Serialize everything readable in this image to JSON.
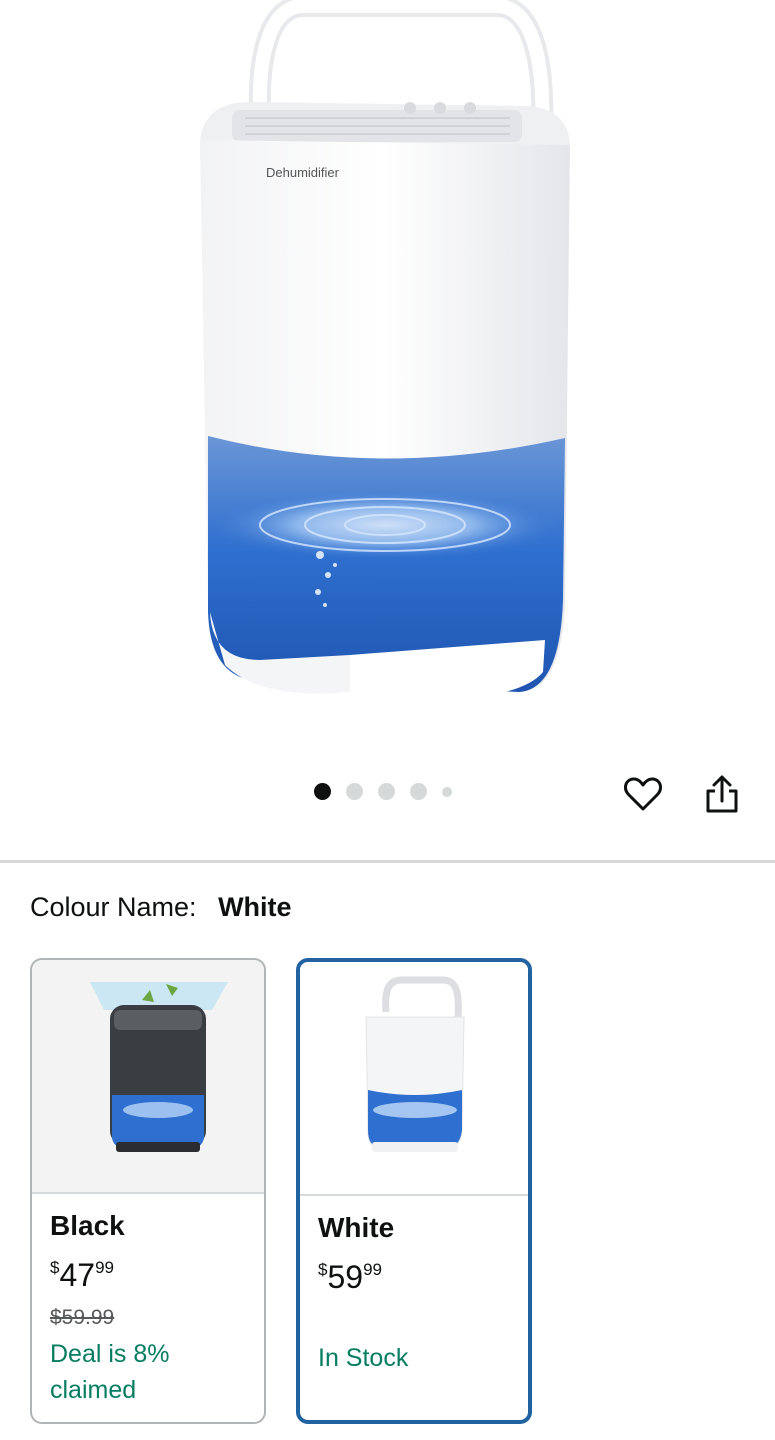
{
  "product_image": {
    "alt": "Dehumidifier",
    "brand_text": "Dehumidifier"
  },
  "carousel": {
    "total": 5,
    "active_index": 0
  },
  "icons": {
    "favorite": "heart-icon",
    "share": "share-icon"
  },
  "colour": {
    "label": "Colour Name:",
    "selected": "White"
  },
  "variants": [
    {
      "name": "Black",
      "price_symbol": "$",
      "price_whole": "47",
      "price_fraction": "99",
      "was_price": "$59.99",
      "status": "Deal is 8% claimed",
      "selected": false
    },
    {
      "name": "White",
      "price_symbol": "$",
      "price_whole": "59",
      "price_fraction": "99",
      "status": "In Stock",
      "selected": true
    }
  ],
  "colors": {
    "selected_border": "#2162a1",
    "deal_green": "#067d62",
    "divider": "#d5d9d9"
  }
}
